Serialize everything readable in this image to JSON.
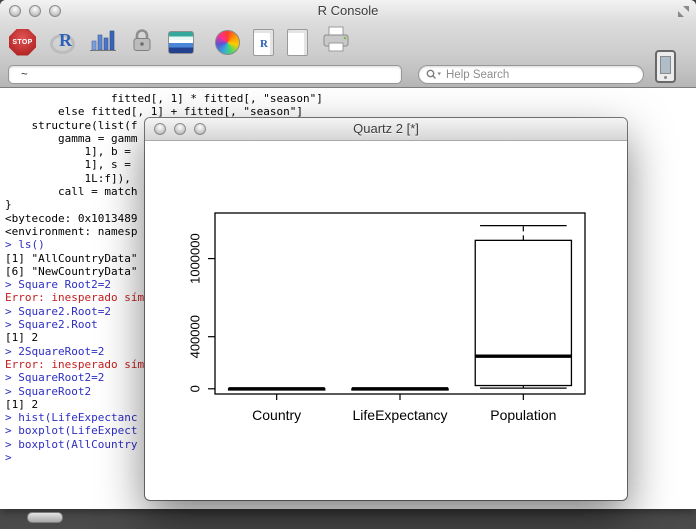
{
  "main_window": {
    "title": "R Console",
    "path_field": "~",
    "search_placeholder": "Help Search"
  },
  "toolbar": {
    "stop_label": "STOP",
    "r_logo_letter": "R",
    "r_doc_letter": "R"
  },
  "console": {
    "lines": [
      {
        "text": "                fitted[, 1] * fitted[, \"season\"]",
        "type": "output"
      },
      {
        "text": "        else fitted[, 1] + fitted[, \"season\"]",
        "type": "output"
      },
      {
        "text": "    structure(list(f",
        "type": "output"
      },
      {
        "text": "        gamma = gamm",
        "type": "output"
      },
      {
        "text": "            1], b = ",
        "type": "output"
      },
      {
        "text": "            1], s = ",
        "type": "output"
      },
      {
        "text": "            1L:f]),",
        "type": "output"
      },
      {
        "text": "        call = match",
        "type": "output"
      },
      {
        "text": "}",
        "type": "output"
      },
      {
        "text": "<bytecode: 0x1013489",
        "type": "output"
      },
      {
        "text": "<environment: namesp",
        "type": "output"
      },
      {
        "text": "> ls()",
        "type": "input"
      },
      {
        "text": "[1] \"AllCountryData\"",
        "type": "output"
      },
      {
        "text": "[6] \"NewCountryData\"",
        "type": "output"
      },
      {
        "text": "> Square Root2=2",
        "type": "input"
      },
      {
        "text": "Error: inesperado sím",
        "type": "error"
      },
      {
        "text": "> Square2.Root=2",
        "type": "input"
      },
      {
        "text": "> Square2.Root",
        "type": "input"
      },
      {
        "text": "[1] 2",
        "type": "output"
      },
      {
        "text": "> 2SquareRoot=2",
        "type": "input"
      },
      {
        "text": "Error: inesperado sím",
        "type": "error"
      },
      {
        "text": "> SquareRoot2=2",
        "type": "input"
      },
      {
        "text": "> SquareRoot2",
        "type": "input"
      },
      {
        "text": "[1] 2",
        "type": "output"
      },
      {
        "text": "> hist(LifeExpectanc",
        "type": "input"
      },
      {
        "text": "> boxplot(LifeExpect",
        "type": "input"
      },
      {
        "text": "> boxplot(AllCountry",
        "type": "input"
      },
      {
        "text": "> ",
        "type": "input"
      }
    ]
  },
  "quartz_window": {
    "title": "Quartz 2 [*]"
  },
  "chart_data": {
    "type": "boxplot",
    "title": "",
    "xlabel": "",
    "ylabel": "",
    "categories": [
      "Country",
      "LifeExpectancy",
      "Population"
    ],
    "y_ticks": [
      0,
      400000,
      1000000
    ],
    "ylim": [
      -40000,
      1350000
    ],
    "grid": false,
    "series": [
      {
        "name": "Country",
        "min": 1,
        "q1": 49,
        "median": 97,
        "q3": 145,
        "max": 193
      },
      {
        "name": "LifeExpectancy",
        "min": 47.8,
        "q1": 62.7,
        "median": 72.2,
        "q3": 76.1,
        "max": 83.1
      },
      {
        "name": "Population",
        "min": 5000,
        "q1": 25000,
        "median": 250000,
        "q3": 1140000,
        "max": 1253000
      }
    ]
  },
  "colors": {
    "input_text": "#2e2ec4",
    "error_text": "#c41e1e",
    "output_text": "#000000"
  }
}
